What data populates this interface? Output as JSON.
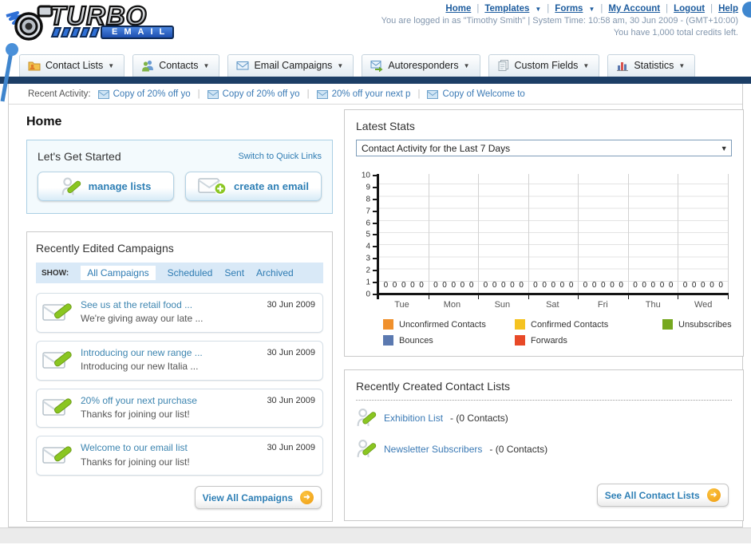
{
  "header": {
    "logo": {
      "title": "TURBO",
      "subtitle": "EMAIL"
    },
    "nav_links": [
      {
        "label": "Home",
        "dropdown": false
      },
      {
        "label": "Templates",
        "dropdown": true
      },
      {
        "label": "Forms",
        "dropdown": true
      },
      {
        "label": "My Account",
        "dropdown": false
      },
      {
        "label": "Logout",
        "dropdown": false
      },
      {
        "label": "Help",
        "dropdown": false
      }
    ],
    "status_line1": "You are logged in as \"Timothy Smith\" | System Time: 10:58 am, 30 Jun 2009 - (GMT+10:00)",
    "status_line2": "You have 1,000 total credits left."
  },
  "tabs": [
    {
      "label": "Contact Lists",
      "icon": "contact-lists-folder-icon"
    },
    {
      "label": "Contacts",
      "icon": "contacts-people-icon"
    },
    {
      "label": "Email Campaigns",
      "icon": "envelope-icon"
    },
    {
      "label": "Autoresponders",
      "icon": "envelope-arrow-icon"
    },
    {
      "label": "Custom Fields",
      "icon": "pages-icon"
    },
    {
      "label": "Statistics",
      "icon": "bar-chart-icon"
    }
  ],
  "recent_activity": {
    "label": "Recent Activity:",
    "items": [
      "Copy of 20% off yo",
      "Copy of 20% off yo",
      "20% off your next p",
      "Copy of Welcome to"
    ]
  },
  "page_title": "Home",
  "get_started": {
    "title": "Let's Get Started",
    "switch_link": "Switch to Quick Links",
    "buttons": [
      {
        "label": "manage lists",
        "icon": "person-pencil-icon"
      },
      {
        "label": "create an email",
        "icon": "envelope-plus-icon"
      }
    ]
  },
  "campaigns": {
    "title": "Recently Edited Campaigns",
    "show_label": "SHOW:",
    "filters": [
      "All Campaigns",
      "Scheduled",
      "Sent",
      "Archived"
    ],
    "active_filter": "All Campaigns",
    "items": [
      {
        "title": "See us at the retail food ...",
        "subtitle": "We're giving away our late ...",
        "date": "30 Jun 2009"
      },
      {
        "title": "Introducing our new range ...",
        "subtitle": "Introducing our new Italia ...",
        "date": "30 Jun 2009"
      },
      {
        "title": "20% off your next purchase",
        "subtitle": "Thanks for joining our list!",
        "date": "30 Jun 2009"
      },
      {
        "title": "Welcome to our email list",
        "subtitle": "Thanks for joining our list!",
        "date": "30 Jun 2009"
      }
    ],
    "view_all_label": "View All Campaigns"
  },
  "stats": {
    "title": "Latest Stats",
    "dropdown_value": "Contact Activity for the Last 7 Days"
  },
  "chart_data": {
    "type": "bar",
    "title": "Contact Activity for the Last 7 Days",
    "categories": [
      "Tue",
      "Mon",
      "Sun",
      "Sat",
      "Fri",
      "Thu",
      "Wed"
    ],
    "series": [
      {
        "name": "Unconfirmed Contacts",
        "color": "#f0902c",
        "values": [
          0,
          0,
          0,
          0,
          0,
          0,
          0
        ]
      },
      {
        "name": "Confirmed Contacts",
        "color": "#f5c321",
        "values": [
          0,
          0,
          0,
          0,
          0,
          0,
          0
        ]
      },
      {
        "name": "Unsubscribes",
        "color": "#76a81f",
        "values": [
          0,
          0,
          0,
          0,
          0,
          0,
          0
        ]
      },
      {
        "name": "Bounces",
        "color": "#5b79b0",
        "values": [
          0,
          0,
          0,
          0,
          0,
          0,
          0
        ]
      },
      {
        "name": "Forwards",
        "color": "#e84928",
        "values": [
          0,
          0,
          0,
          0,
          0,
          0,
          0
        ]
      }
    ],
    "ylim": [
      0,
      10
    ],
    "y_ticks": [
      "10",
      "9",
      "8",
      "7",
      "6",
      "5",
      "4",
      "3",
      "2",
      "1",
      "0"
    ],
    "grid": true,
    "legend_position": "bottom"
  },
  "contact_lists": {
    "title": "Recently Created Contact Lists",
    "items": [
      {
        "name": "Exhibition List",
        "suffix": "- (0 Contacts)"
      },
      {
        "name": "Newsletter Subscribers",
        "suffix": "- (0 Contacts)"
      }
    ],
    "see_all_label": "See All Contact Lists"
  }
}
